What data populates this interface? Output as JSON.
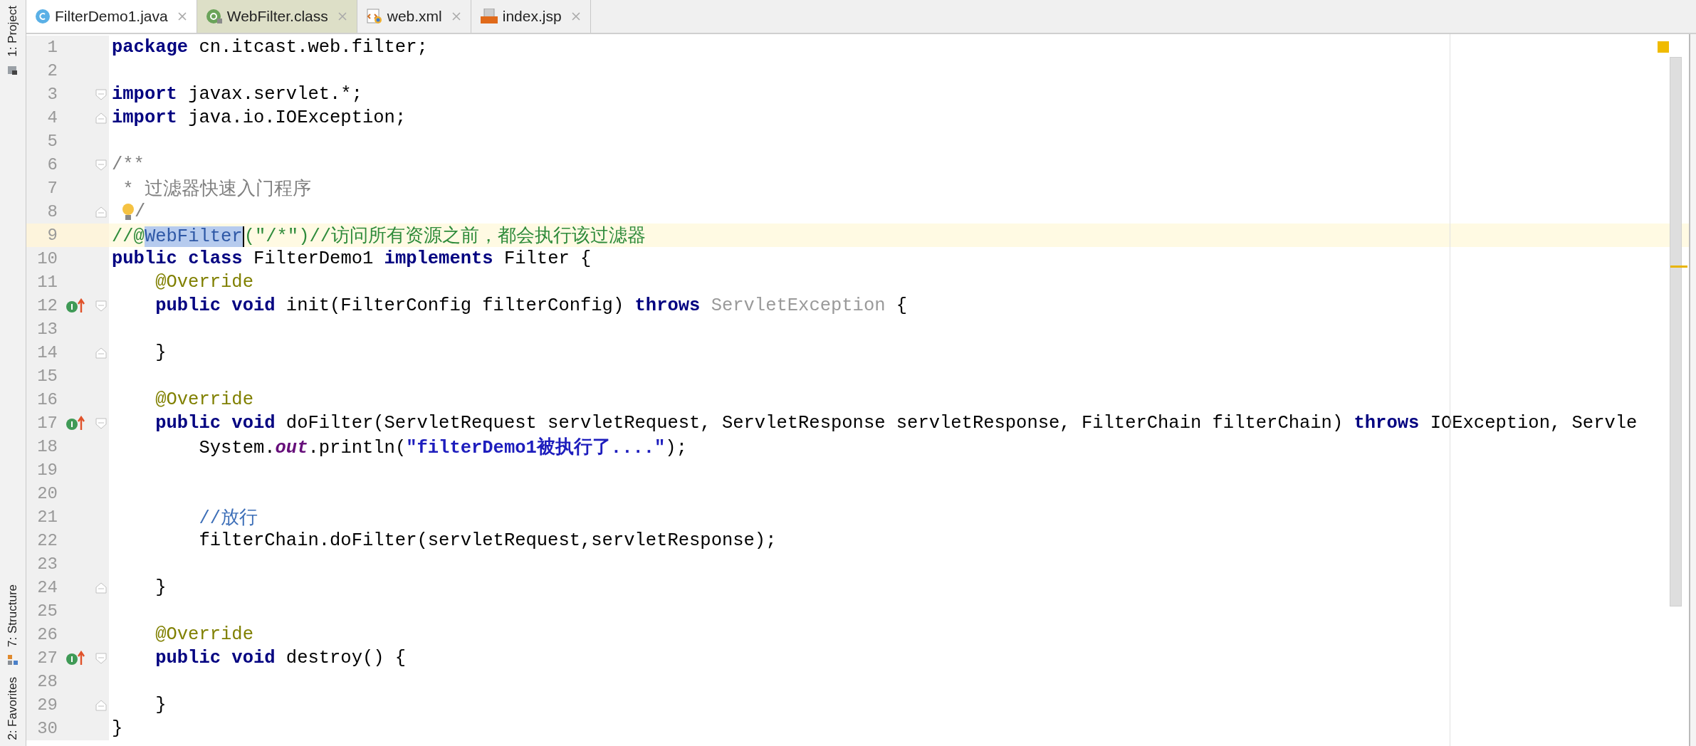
{
  "tool_windows_top": [
    {
      "label": "1: Project"
    }
  ],
  "tool_windows_bottom": [
    {
      "label": "7: Structure"
    },
    {
      "label": "2: Favorites"
    }
  ],
  "tabs": [
    {
      "label": "FilterDemo1.java",
      "selected": true,
      "library": false
    },
    {
      "label": "WebFilter.class",
      "selected": false,
      "library": true
    },
    {
      "label": "web.xml",
      "selected": false,
      "library": false
    },
    {
      "label": "index.jsp",
      "selected": false,
      "library": false
    }
  ],
  "lines": [
    {
      "number": "1",
      "current": false,
      "implements": false,
      "fold_start": false,
      "fold_end": false,
      "tokens": [
        {
          "text": "package",
          "kind": "keyword"
        },
        {
          "text": " cn.itcast.web.filter;",
          "kind": "plain"
        }
      ]
    },
    {
      "number": "2",
      "current": false,
      "implements": false,
      "fold_start": false,
      "fold_end": false
    },
    {
      "number": "3",
      "current": false,
      "implements": false,
      "fold_start": true,
      "fold_end": false,
      "tokens": [
        {
          "text": "import",
          "kind": "keyword"
        },
        {
          "text": " javax.servlet.*;",
          "kind": "plain"
        }
      ]
    },
    {
      "number": "4",
      "current": false,
      "implements": false,
      "fold_start": false,
      "fold_end": true,
      "tokens": [
        {
          "text": "import",
          "kind": "keyword"
        },
        {
          "text": " java.io.IOException;",
          "kind": "plain"
        }
      ]
    },
    {
      "number": "5",
      "current": false,
      "implements": false,
      "fold_start": false,
      "fold_end": false
    },
    {
      "number": "6",
      "current": false,
      "implements": false,
      "fold_start": true,
      "fold_end": false,
      "tokens": [
        {
          "text": "/**",
          "kind": "doc"
        }
      ]
    },
    {
      "number": "7",
      "current": false,
      "implements": false,
      "fold_start": false,
      "fold_end": false,
      "tokens": [
        {
          "text": " * 过滤器快速入门程序",
          "kind": "doc"
        }
      ]
    },
    {
      "number": "8",
      "current": false,
      "implements": false,
      "fold_start": false,
      "fold_end": true,
      "tokens": [
        {
          "kind": "bulb"
        },
        {
          "text": "/",
          "kind": "doc"
        }
      ]
    },
    {
      "number": "9",
      "current": true,
      "implements": false,
      "fold_start": false,
      "fold_end": false,
      "tokens": [
        {
          "text": "//@",
          "kind": "comment"
        },
        {
          "text": "WebFilter",
          "kind": "selected"
        },
        {
          "text": "(\"/*\")//访问所有资源之前，都会执行该过滤器",
          "kind": "comment"
        }
      ]
    },
    {
      "number": "10",
      "current": false,
      "implements": false,
      "fold_start": false,
      "fold_end": false,
      "tokens": [
        {
          "text": "public",
          "kind": "keyword"
        },
        {
          "text": " class",
          "kind": "keyword"
        },
        {
          "text": " FilterDemo1 ",
          "kind": "plain"
        },
        {
          "text": "implements",
          "kind": "keyword"
        },
        {
          "text": " Filter {",
          "kind": "plain"
        }
      ]
    },
    {
      "number": "11",
      "current": false,
      "implements": false,
      "fold_start": false,
      "fold_end": false,
      "tokens": [
        {
          "text": "    @Override",
          "kind": "annotation"
        }
      ]
    },
    {
      "number": "12",
      "current": false,
      "implements": true,
      "fold_start": true,
      "fold_end": false,
      "tokens": [
        {
          "text": "    public",
          "kind": "keyword"
        },
        {
          "text": " void",
          "kind": "keyword"
        },
        {
          "text": " init(FilterConfig filterConfig) ",
          "kind": "plain"
        },
        {
          "text": "throws",
          "kind": "keyword"
        },
        {
          "text": " ServletException",
          "kind": "unused"
        },
        {
          "text": " {",
          "kind": "plain"
        }
      ]
    },
    {
      "number": "13",
      "current": false,
      "implements": false,
      "fold_start": false,
      "fold_end": false
    },
    {
      "number": "14",
      "current": false,
      "implements": false,
      "fold_start": false,
      "fold_end": true,
      "tokens": [
        {
          "text": "    }",
          "kind": "plain"
        }
      ]
    },
    {
      "number": "15",
      "current": false,
      "implements": false,
      "fold_start": false,
      "fold_end": false
    },
    {
      "number": "16",
      "current": false,
      "implements": false,
      "fold_start": false,
      "fold_end": false,
      "tokens": [
        {
          "text": "    @Override",
          "kind": "annotation"
        }
      ]
    },
    {
      "number": "17",
      "current": false,
      "implements": true,
      "fold_start": true,
      "fold_end": false,
      "tokens": [
        {
          "text": "    public",
          "kind": "keyword"
        },
        {
          "text": " void",
          "kind": "keyword"
        },
        {
          "text": " doFilter(ServletRequest servletRequest, ServletResponse servletResponse, FilterChain filterChain) ",
          "kind": "plain"
        },
        {
          "text": "throws",
          "kind": "keyword"
        },
        {
          "text": " IOException, Servle",
          "kind": "plain"
        }
      ]
    },
    {
      "number": "18",
      "current": false,
      "implements": false,
      "fold_start": false,
      "fold_end": false,
      "tokens": [
        {
          "text": "        System.",
          "kind": "plain"
        },
        {
          "text": "out",
          "kind": "static"
        },
        {
          "text": ".println(",
          "kind": "plain"
        },
        {
          "text": "\"filterDemo1被执行了....\"",
          "kind": "string"
        },
        {
          "text": ");",
          "kind": "plain"
        }
      ]
    },
    {
      "number": "19",
      "current": false,
      "implements": false,
      "fold_start": false,
      "fold_end": false
    },
    {
      "number": "20",
      "current": false,
      "implements": false,
      "fold_start": false,
      "fold_end": false
    },
    {
      "number": "21",
      "current": false,
      "implements": false,
      "fold_start": false,
      "fold_end": false,
      "tokens": [
        {
          "text": "        //放行",
          "kind": "note"
        }
      ]
    },
    {
      "number": "22",
      "current": false,
      "implements": false,
      "fold_start": false,
      "fold_end": false,
      "tokens": [
        {
          "text": "        filterChain.doFilter(servletRequest,servletResponse);",
          "kind": "plain"
        }
      ]
    },
    {
      "number": "23",
      "current": false,
      "implements": false,
      "fold_start": false,
      "fold_end": false
    },
    {
      "number": "24",
      "current": false,
      "implements": false,
      "fold_start": false,
      "fold_end": true,
      "tokens": [
        {
          "text": "    }",
          "kind": "plain"
        }
      ]
    },
    {
      "number": "25",
      "current": false,
      "implements": false,
      "fold_start": false,
      "fold_end": false
    },
    {
      "number": "26",
      "current": false,
      "implements": false,
      "fold_start": false,
      "fold_end": false,
      "tokens": [
        {
          "text": "    @Override",
          "kind": "annotation"
        }
      ]
    },
    {
      "number": "27",
      "current": false,
      "implements": true,
      "fold_start": true,
      "fold_end": false,
      "tokens": [
        {
          "text": "    public",
          "kind": "keyword"
        },
        {
          "text": " void",
          "kind": "keyword"
        },
        {
          "text": " destroy() {",
          "kind": "plain"
        }
      ]
    },
    {
      "number": "28",
      "current": false,
      "implements": false,
      "fold_start": false,
      "fold_end": false
    },
    {
      "number": "29",
      "current": false,
      "implements": false,
      "fold_start": false,
      "fold_end": true,
      "tokens": [
        {
          "text": "    }",
          "kind": "plain"
        }
      ]
    },
    {
      "number": "30",
      "current": false,
      "implements": false,
      "fold_start": false,
      "fold_end": false,
      "tokens": [
        {
          "text": "}",
          "kind": "plain"
        }
      ]
    }
  ]
}
